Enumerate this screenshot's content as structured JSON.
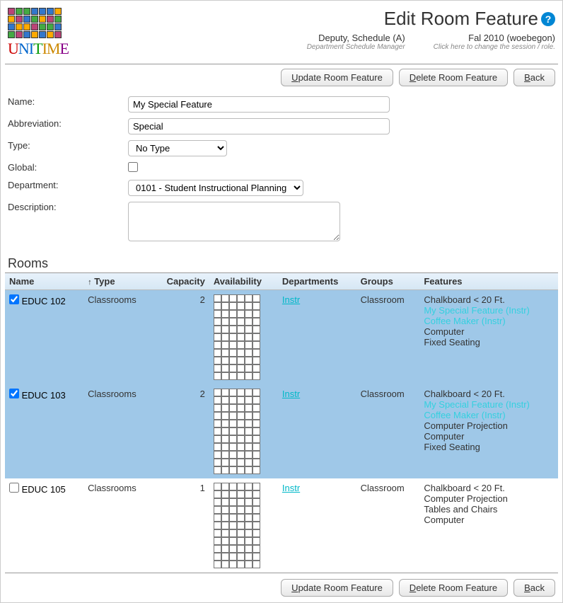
{
  "header": {
    "title": "Edit Room Feature",
    "user": {
      "line1": "Deputy, Schedule (A)",
      "line2": "Department Schedule Manager"
    },
    "session": {
      "line1": "Fal 2010 (woebegon)",
      "line2": "Click here to change the session / role."
    },
    "logo_text": "UniTime"
  },
  "buttons": {
    "update": {
      "pre": "U",
      "rest": "pdate Room Feature"
    },
    "delete": {
      "pre": "D",
      "rest": "elete Room Feature"
    },
    "back": {
      "pre": "B",
      "rest": "ack"
    }
  },
  "form": {
    "name_label": "Name:",
    "name_value": "My Special Feature",
    "abbr_label": "Abbreviation:",
    "abbr_value": "Special",
    "type_label": "Type:",
    "type_value": "No Type",
    "global_label": "Global:",
    "global_checked": false,
    "dept_label": "Department:",
    "dept_value": "0101 - Student Instructional Planning",
    "desc_label": "Description:",
    "desc_value": ""
  },
  "rooms_section": "Rooms",
  "columns": {
    "name": "Name",
    "type": "Type",
    "capacity": "Capacity",
    "availability": "Availability",
    "departments": "Departments",
    "groups": "Groups",
    "features": "Features",
    "sort_indicator": "↑"
  },
  "rows": [
    {
      "checked": true,
      "selected": true,
      "name": "EDUC 102",
      "type": "Classrooms",
      "capacity": "2",
      "dept": "Instr",
      "group": "Classroom",
      "features": [
        {
          "text": "Chalkboard < 20 Ft.",
          "hl": false
        },
        {
          "text": "My Special Feature (Instr)",
          "hl": true
        },
        {
          "text": "Coffee Maker (Instr)",
          "hl": true
        },
        {
          "text": "Computer",
          "hl": false
        },
        {
          "text": "Fixed Seating",
          "hl": false
        }
      ]
    },
    {
      "checked": true,
      "selected": true,
      "name": "EDUC 103",
      "type": "Classrooms",
      "capacity": "2",
      "dept": "Instr",
      "group": "Classroom",
      "features": [
        {
          "text": "Chalkboard < 20 Ft.",
          "hl": false
        },
        {
          "text": "My Special Feature (Instr)",
          "hl": true
        },
        {
          "text": "Coffee Maker (Instr)",
          "hl": true
        },
        {
          "text": "Computer Projection",
          "hl": false
        },
        {
          "text": "Computer",
          "hl": false
        },
        {
          "text": "Fixed Seating",
          "hl": false
        }
      ]
    },
    {
      "checked": false,
      "selected": false,
      "name": "EDUC 105",
      "type": "Classrooms",
      "capacity": "1",
      "dept": "Instr",
      "group": "Classroom",
      "features": [
        {
          "text": "Chalkboard < 20 Ft.",
          "hl": false
        },
        {
          "text": "Computer Projection",
          "hl": false
        },
        {
          "text": "Tables and Chairs",
          "hl": false
        },
        {
          "text": "Computer",
          "hl": false
        }
      ]
    }
  ]
}
